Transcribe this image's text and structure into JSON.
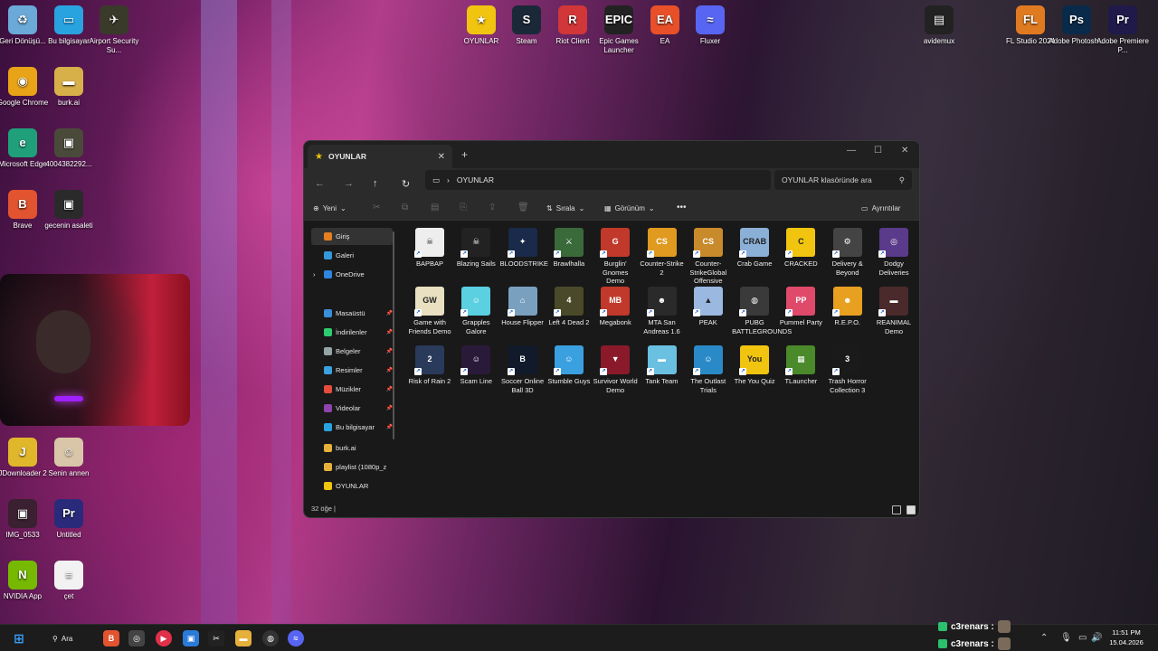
{
  "desktop": {
    "icons_left": [
      {
        "label": "Geri Dönüşü...",
        "color": "#6aa9d8",
        "glyph": "♻",
        "icon": "recycle-bin-icon"
      },
      {
        "label": "Bu bilgisayar",
        "color": "#29a3e0",
        "glyph": "▭",
        "icon": "computer-icon"
      },
      {
        "label": "Airport Security Su...",
        "color": "#3a3a2a",
        "glyph": "✈",
        "icon": "game-icon"
      },
      {
        "label": "Google Chrome",
        "color": "#e8a317",
        "glyph": "◉",
        "icon": "chrome-icon"
      },
      {
        "label": "burk.ai",
        "color": "#d8b04a",
        "glyph": "▬",
        "icon": "folder-icon"
      },
      {
        "label": "Microsoft Edge",
        "color": "#1fa07a",
        "glyph": "e",
        "icon": "edge-icon"
      },
      {
        "label": "4004382292...",
        "color": "#4a4a3a",
        "glyph": "▣",
        "icon": "image-icon"
      },
      {
        "label": "Brave",
        "color": "#e2532f",
        "glyph": "B",
        "icon": "brave-icon"
      },
      {
        "label": "gecenin asaleti",
        "color": "#2a2a2a",
        "glyph": "▣",
        "icon": "video-icon"
      },
      {
        "label": "JDownloader 2",
        "color": "#e0b72a",
        "glyph": "J",
        "icon": "jdownloader-icon"
      },
      {
        "label": "Senin annen",
        "color": "#d9c6a9",
        "glyph": "☺",
        "icon": "image-icon"
      },
      {
        "label": "IMG_0533",
        "color": "#3a2030",
        "glyph": "▣",
        "icon": "image-icon"
      },
      {
        "label": "Untitled",
        "color": "#2a2a7a",
        "glyph": "Pr",
        "icon": "premiere-project-icon"
      },
      {
        "label": "NVIDIA App",
        "color": "#76b900",
        "glyph": "N",
        "icon": "nvidia-icon"
      },
      {
        "label": "çet",
        "color": "#f2f2f2",
        "glyph": "≡",
        "icon": "document-icon"
      }
    ],
    "icons_top": [
      {
        "label": "OYUNLAR",
        "color": "#f1c40f",
        "glyph": "★",
        "icon": "star-folder-icon"
      },
      {
        "label": "Steam",
        "color": "#1b2838",
        "glyph": "S",
        "icon": "steam-icon"
      },
      {
        "label": "Riot Client",
        "color": "#d13639",
        "glyph": "R",
        "icon": "riot-icon"
      },
      {
        "label": "Epic Games Launcher",
        "color": "#222",
        "glyph": "EPIC",
        "icon": "epic-icon"
      },
      {
        "label": "EA",
        "color": "#e8502a",
        "glyph": "EA",
        "icon": "ea-icon"
      },
      {
        "label": "Fluxer",
        "color": "#5865f2",
        "glyph": "≈",
        "icon": "fluxer-icon"
      },
      {
        "label": "avidemux",
        "color": "#222",
        "glyph": "▤",
        "icon": "avidemux-icon"
      },
      {
        "label": "FL Studio 2024",
        "color": "#e07a20",
        "glyph": "FL",
        "icon": "fl-studio-icon"
      },
      {
        "label": "Adobe Photosh...",
        "color": "#0a2a4a",
        "glyph": "Ps",
        "icon": "photoshop-icon"
      },
      {
        "label": "Adobe Premiere P...",
        "color": "#1f1a4a",
        "glyph": "Pr",
        "icon": "premiere-icon"
      }
    ]
  },
  "explorer": {
    "tab_title": "OYUNLAR",
    "path_segment": "OYUNLAR",
    "search_placeholder": "OYUNLAR klasöründe ara",
    "cmd": {
      "new": "Yeni",
      "sort": "Sırala",
      "view": "Görünüm",
      "more": "•••",
      "details": "Ayrıntılar"
    },
    "sidebar": [
      {
        "label": "Giriş",
        "color": "#e67e22",
        "pin": false,
        "active": true
      },
      {
        "label": "Galeri",
        "color": "#3498db",
        "pin": false
      },
      {
        "label": "OneDrive",
        "color": "#2e86de",
        "pin": false,
        "expand": true
      },
      {
        "label": "Masaüstü",
        "color": "#3a8fd9",
        "pin": true
      },
      {
        "label": "İndirilenler",
        "color": "#2ecc71",
        "pin": true
      },
      {
        "label": "Belgeler",
        "color": "#95a5a6",
        "pin": true
      },
      {
        "label": "Resimler",
        "color": "#3aa0e0",
        "pin": true
      },
      {
        "label": "Müzikler",
        "color": "#e74c3c",
        "pin": true
      },
      {
        "label": "Videolar",
        "color": "#8e44ad",
        "pin": true
      },
      {
        "label": "Bu bilgisayar",
        "color": "#29a3e0",
        "pin": true
      },
      {
        "label": "burk.ai",
        "color": "#e6b13a",
        "pin": false
      },
      {
        "label": "playlist (1080p_z",
        "color": "#e6b13a",
        "pin": false
      },
      {
        "label": "OYUNLAR",
        "color": "#f1c40f",
        "pin": false
      }
    ],
    "files": [
      {
        "label": "BAPBAP",
        "color": "#eeeeee",
        "glyph": "☠"
      },
      {
        "label": "Blazing Sails",
        "color": "#222222",
        "glyph": "☠"
      },
      {
        "label": "BLOODSTRIKE",
        "color": "#1a2a4a",
        "glyph": "✦"
      },
      {
        "label": "Brawlhalla",
        "color": "#3a6a3a",
        "glyph": "⚔"
      },
      {
        "label": "Burglin' Gnomes Demo",
        "color": "#c0392b",
        "glyph": "G"
      },
      {
        "label": "Counter-Strike 2",
        "color": "#e09a20",
        "glyph": "CS"
      },
      {
        "label": "Counter-StrikeGlobal Offensive",
        "color": "#c88a2a",
        "glyph": "CS"
      },
      {
        "label": "Crab Game",
        "color": "#8ab0d8",
        "glyph": "CRAB"
      },
      {
        "label": "CRACKED",
        "color": "#f1c40f",
        "glyph": "C"
      },
      {
        "label": "Delivery & Beyond",
        "color": "#444444",
        "glyph": "⚙"
      },
      {
        "label": "Dodgy Deliveries",
        "color": "#5a3a8a",
        "glyph": "◎"
      },
      {
        "label": "Game with Friends Demo",
        "color": "#e8e0c0",
        "glyph": "GW"
      },
      {
        "label": "Grapples Galore",
        "color": "#5ad0e0",
        "glyph": "☺"
      },
      {
        "label": "House Flipper",
        "color": "#7aa0c0",
        "glyph": "⌂"
      },
      {
        "label": "Left 4 Dead 2",
        "color": "#4a4a2a",
        "glyph": "4"
      },
      {
        "label": "Megabonk",
        "color": "#c0392b",
        "glyph": "MB"
      },
      {
        "label": "MTA San Andreas 1.6",
        "color": "#2a2a2a",
        "glyph": "☻"
      },
      {
        "label": "PEAK",
        "color": "#9ab8e0",
        "glyph": "▲"
      },
      {
        "label": "PUBG BATTLEGROUNDS",
        "color": "#3a3a3a",
        "glyph": "◍"
      },
      {
        "label": "Pummel Party",
        "color": "#e04a6a",
        "glyph": "PP"
      },
      {
        "label": "R.E.P.O.",
        "color": "#e8a020",
        "glyph": "☻"
      },
      {
        "label": "REANIMAL Demo",
        "color": "#4a2a2a",
        "glyph": "▬"
      },
      {
        "label": "Risk of Rain 2",
        "color": "#2a3a5a",
        "glyph": "2"
      },
      {
        "label": "Scam Line",
        "color": "#2a1a3a",
        "glyph": "☺"
      },
      {
        "label": "Soccer Online Ball 3D",
        "color": "#101a2a",
        "glyph": "B"
      },
      {
        "label": "Stumble Guys",
        "color": "#3aa0e0",
        "glyph": "☺"
      },
      {
        "label": "Survivor World Demo",
        "color": "#8a1a2a",
        "glyph": "▼"
      },
      {
        "label": "Tank Team",
        "color": "#6ac0e0",
        "glyph": "▬"
      },
      {
        "label": "The Outlast Trials",
        "color": "#2a8ac8",
        "glyph": "☺"
      },
      {
        "label": "The You Quiz",
        "color": "#f1c40f",
        "glyph": "You"
      },
      {
        "label": "TLauncher",
        "color": "#4a8a2a",
        "glyph": "▦"
      },
      {
        "label": "Trash Horror Collection 3",
        "color": "#1a1a1a",
        "glyph": "3"
      }
    ],
    "status": "32 öğe"
  },
  "taskbar": {
    "search_label": "Ara",
    "chat": [
      {
        "user": "c3renars :"
      },
      {
        "user": "c3renars :"
      }
    ],
    "time": "11:51 PM",
    "date": "15.04.2026"
  }
}
